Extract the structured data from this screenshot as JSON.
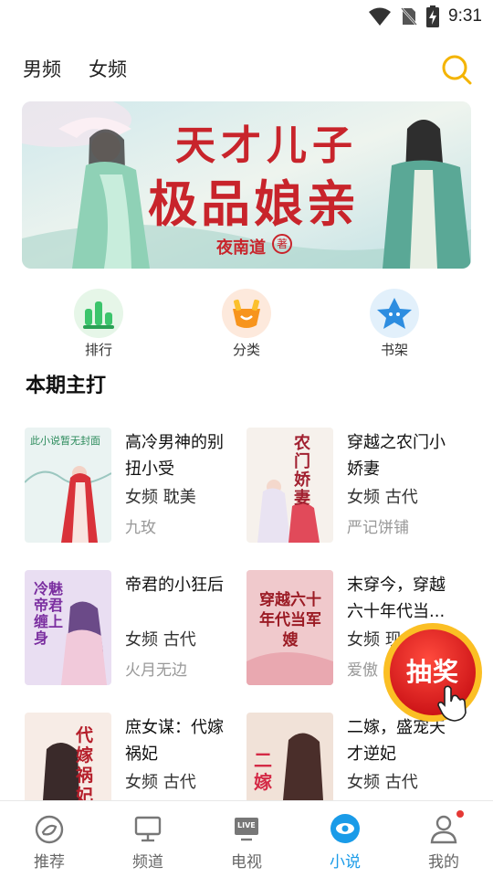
{
  "status": {
    "time": "9:31"
  },
  "header": {
    "tabs": [
      "男频",
      "女频"
    ]
  },
  "banner": {
    "line1": "天才儿子",
    "line2": "极品娘亲",
    "author": "夜南道",
    "seal": "著"
  },
  "quick": [
    {
      "label": "排行",
      "icon": "ranking-icon"
    },
    {
      "label": "分类",
      "icon": "category-icon"
    },
    {
      "label": "书架",
      "icon": "bookshelf-icon"
    }
  ],
  "section": {
    "title": "本期主打"
  },
  "books": [
    {
      "title": "高冷男神的别扭小受",
      "tags": "女频 耽美",
      "author": "九玫",
      "cover_text": "此小说暂无封面"
    },
    {
      "title": "穿越之农门小娇妻",
      "tags": "女频 古代",
      "author": "严记饼铺",
      "cover_text": "农门娇妻"
    },
    {
      "title": "帝君的小狂后",
      "tags": "女频 古代",
      "author": "火月无边",
      "cover_text": "冷魅帝君缠上身"
    },
    {
      "title": "末穿今，穿越六十年代当...",
      "tags": "女频 现",
      "author": "爱傲",
      "cover_text": "穿越六十年代当军嫂"
    },
    {
      "title": "庶女谋：代嫁祸妃",
      "tags": "女频 古代",
      "author": "",
      "cover_text": "代嫁祸妃"
    },
    {
      "title": "二嫁，盛宠天才逆妃",
      "tags": "女频 古代",
      "author": "",
      "cover_text": "二嫁"
    }
  ],
  "lottery": {
    "label": "抽奖"
  },
  "bottom_nav": [
    {
      "label": "推荐",
      "icon": "recommend-icon"
    },
    {
      "label": "频道",
      "icon": "channel-icon"
    },
    {
      "label": "电视",
      "icon": "tv-icon",
      "badge": "LIVE"
    },
    {
      "label": "小说",
      "icon": "novel-icon",
      "active": true
    },
    {
      "label": "我的",
      "icon": "profile-icon"
    }
  ],
  "colors": {
    "accent": "#1a9be8",
    "search": "#f4b400",
    "lottery": "#e5141a"
  }
}
